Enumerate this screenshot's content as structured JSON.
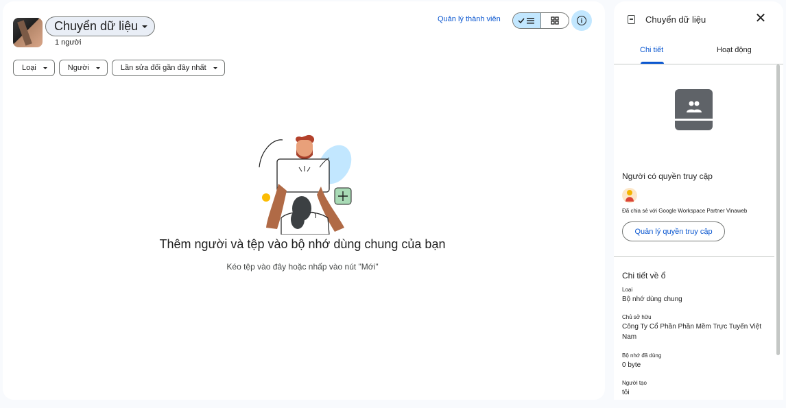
{
  "drive": {
    "name": "Chuyển dữ liệu",
    "members": "1 người"
  },
  "toolbar": {
    "manage_members": "Quản lý thành viên",
    "view_list_icon": "check-list-icon",
    "view_grid_icon": "grid-icon",
    "info_icon": "info-icon"
  },
  "filters": [
    {
      "label": "Loại"
    },
    {
      "label": "Người"
    },
    {
      "label": "Lần sửa đổi gần đây nhất"
    }
  ],
  "empty_state": {
    "title": "Thêm người và tệp vào bộ nhớ dùng chung của bạn",
    "subtitle": "Kéo tệp vào đây hoặc nhấp vào nút \"Mới\""
  },
  "panel": {
    "title": "Chuyển dữ liệu",
    "tabs": [
      {
        "label": "Chi tiết",
        "active": true
      },
      {
        "label": "Hoạt động",
        "active": false
      }
    ],
    "access": {
      "title": "Người có quyền truy cập",
      "shared_with": "Đã chia sẻ với Google Workspace Partner Vinaweb",
      "manage_button": "Quản lý quyền truy cập"
    },
    "details": {
      "title": "Chi tiết về ổ",
      "fields": [
        {
          "label": "Loại",
          "value": "Bộ nhớ dùng chung"
        },
        {
          "label": "Chủ sở hữu",
          "value": "Công Ty Cổ Phần Phần Mềm Trực Tuyến Việt Nam"
        },
        {
          "label": "Bộ nhớ đã dùng",
          "value": "0 byte"
        },
        {
          "label": "Người tạo",
          "value": "tôi"
        }
      ]
    }
  },
  "colors": {
    "accent": "#0b57d0",
    "chip_bg": "#e9eef6",
    "selected": "#c2e7ff"
  }
}
